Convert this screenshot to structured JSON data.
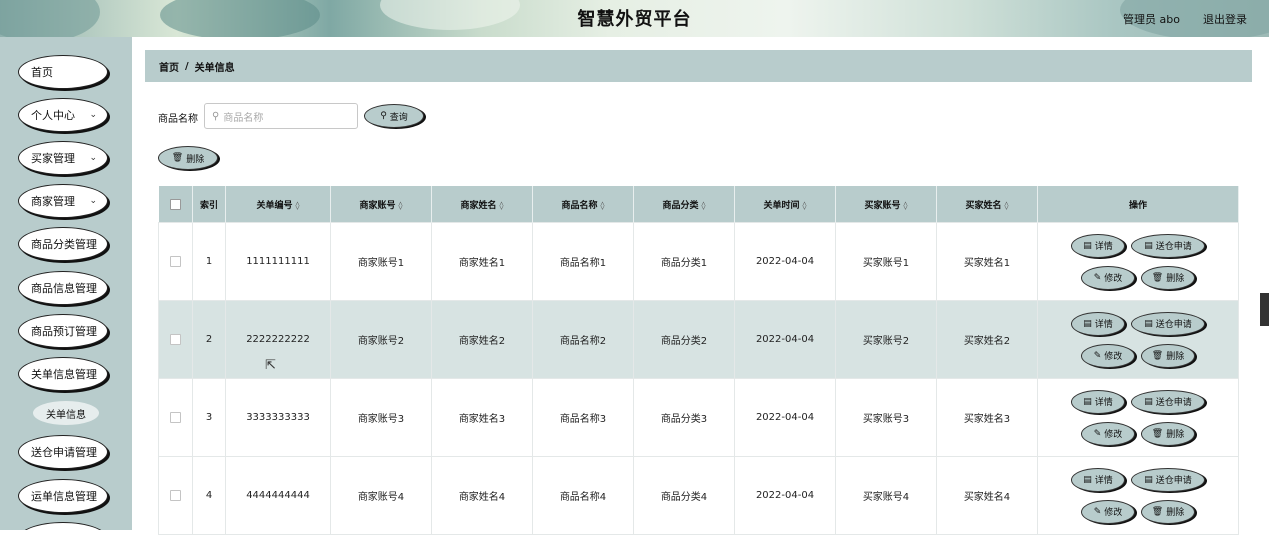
{
  "header": {
    "title": "智慧外贸平台",
    "user": "管理员 abo",
    "logout": "退出登录"
  },
  "sidebar": {
    "items": [
      {
        "label": "首页",
        "chevron": false
      },
      {
        "label": "个人中心",
        "chevron": true
      },
      {
        "label": "买家管理",
        "chevron": true
      },
      {
        "label": "商家管理",
        "chevron": true
      },
      {
        "label": "商品分类管理",
        "chevron": false
      },
      {
        "label": "商品信息管理",
        "chevron": false
      },
      {
        "label": "商品预订管理",
        "chevron": false
      },
      {
        "label": "关单信息管理",
        "chevron": false
      },
      {
        "label": "送仓申请管理",
        "chevron": false
      },
      {
        "label": "运单信息管理",
        "chevron": false
      }
    ],
    "sub_item": "关单信息"
  },
  "breadcrumb": {
    "home": "首页",
    "separator": "/",
    "current": "关单信息"
  },
  "search": {
    "label": "商品名称",
    "placeholder": "商品名称",
    "button": "查询"
  },
  "toolbar": {
    "delete": "删除"
  },
  "table": {
    "columns": [
      "索引",
      "关单编号",
      "商家账号",
      "商家姓名",
      "商品名称",
      "商品分类",
      "关单时间",
      "买家账号",
      "买家姓名",
      "操作"
    ],
    "rows": [
      {
        "index": "1",
        "no": "1111111111",
        "merchant_account": "商家账号1",
        "merchant_name": "商家姓名1",
        "product_name": "商品名称1",
        "category": "商品分类1",
        "time": "2022-04-04",
        "buyer_account": "买家账号1",
        "buyer_name": "买家姓名1"
      },
      {
        "index": "2",
        "no": "2222222222",
        "merchant_account": "商家账号2",
        "merchant_name": "商家姓名2",
        "product_name": "商品名称2",
        "category": "商品分类2",
        "time": "2022-04-04",
        "buyer_account": "买家账号2",
        "buyer_name": "买家姓名2"
      },
      {
        "index": "3",
        "no": "3333333333",
        "merchant_account": "商家账号3",
        "merchant_name": "商家姓名3",
        "product_name": "商品名称3",
        "category": "商品分类3",
        "time": "2022-04-04",
        "buyer_account": "买家账号3",
        "buyer_name": "买家姓名3"
      },
      {
        "index": "4",
        "no": "4444444444",
        "merchant_account": "商家账号4",
        "merchant_name": "商家姓名4",
        "product_name": "商品名称4",
        "category": "商品分类4",
        "time": "2022-04-04",
        "buyer_account": "买家账号4",
        "buyer_name": "买家姓名4"
      }
    ],
    "actions": {
      "detail": "详情",
      "send": "送仓申请",
      "edit": "修改",
      "delete": "删除"
    }
  },
  "colors": {
    "accent": "#b8cccc",
    "row_alt": "#d7e3e2"
  }
}
